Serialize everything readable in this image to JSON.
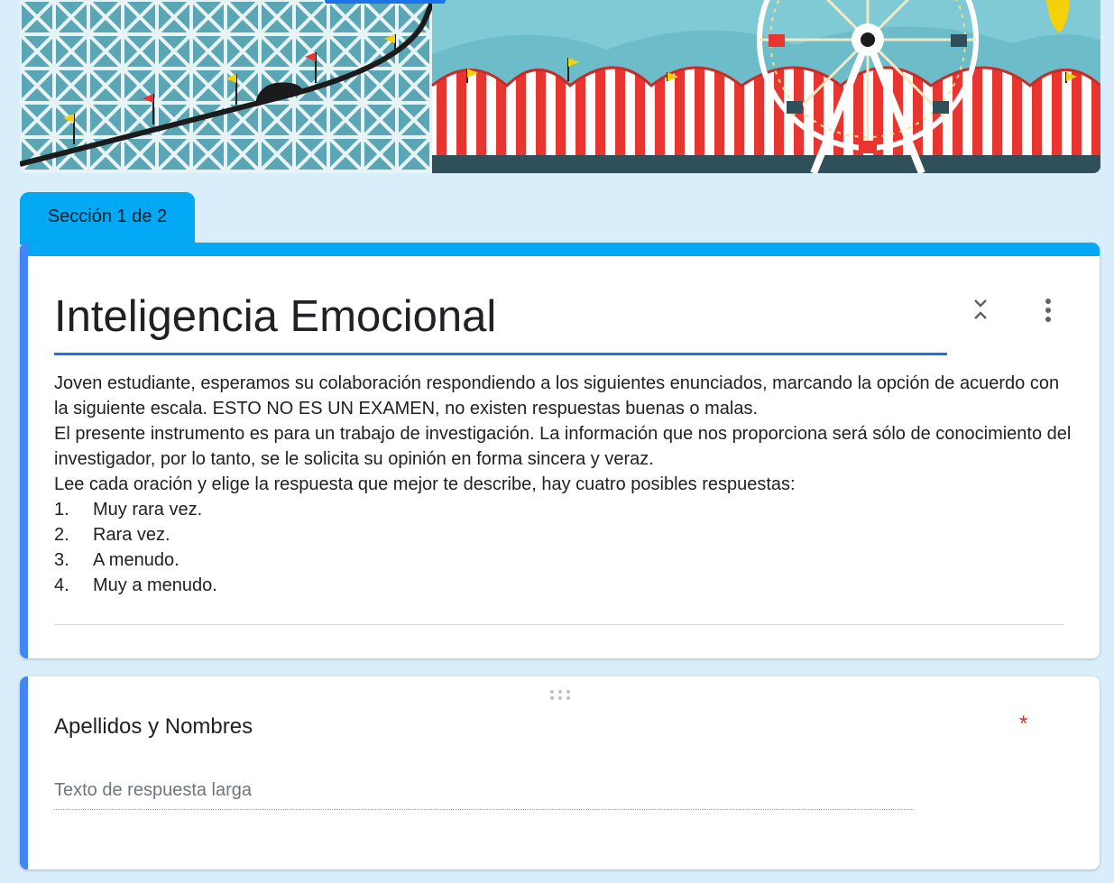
{
  "section_tab": {
    "label": "Sección 1 de 2"
  },
  "form": {
    "title": "Inteligencia Emocional",
    "description": {
      "paragraphs": [
        "Joven estudiante, esperamos su colaboración respondiendo a los siguientes enunciados, marcando la opción de acuerdo con la siguiente escala.  ESTO NO ES UN EXAMEN, no existen respuestas buenas o malas.",
        "El presente instrumento es para un trabajo de investigación. La información que nos proporciona será sólo de conocimiento del investigador, por lo tanto, se le solicita su opinión en forma sincera y veraz.",
        "Lee cada oración y elige la respuesta que mejor te describe, hay cuatro posibles respuestas:"
      ],
      "scale": [
        {
          "num": "1.",
          "label": "Muy rara vez."
        },
        {
          "num": "2.",
          "label": "Rara vez."
        },
        {
          "num": "3.",
          "label": "A menudo."
        },
        {
          "num": "4.",
          "label": "Muy a menudo."
        }
      ]
    },
    "icons": {
      "collapse": "collapse-chevrons-icon",
      "more": "more-vert-icon"
    }
  },
  "question": {
    "title": "Apellidos y Nombres",
    "required_marker": "*",
    "answer_placeholder": "Texto de respuesta larga"
  },
  "colors": {
    "page_background": "#d9eefb",
    "accent": "#03a9f4",
    "focus_blue": "#4285f4",
    "required": "#d93025"
  }
}
